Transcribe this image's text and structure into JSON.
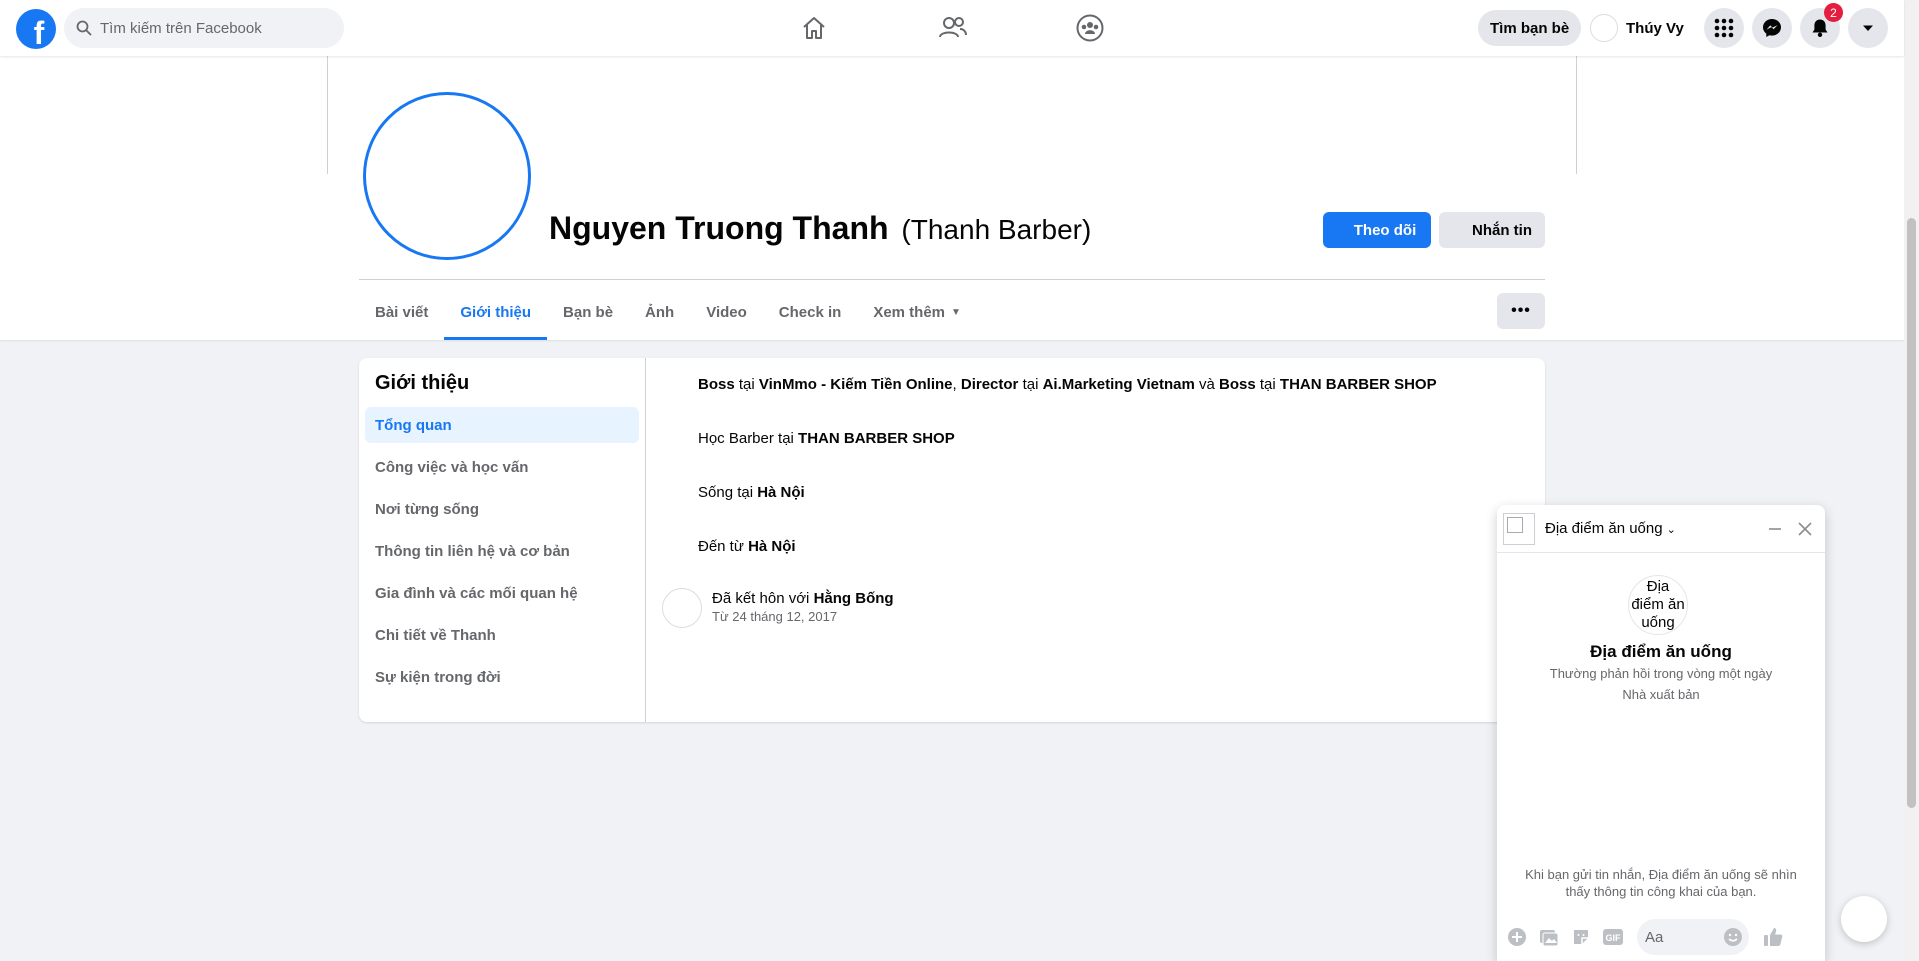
{
  "topbar": {
    "logo_letter": "f",
    "search_placeholder": "Tìm kiếm trên Facebook",
    "find_friends_label": "Tìm bạn bè",
    "user_name": "Thúy Vy",
    "notifications_badge": "2",
    "brand_color": "#1877f2"
  },
  "profile": {
    "name": "Nguyen Truong Thanh",
    "alt_name": "(Thanh Barber)",
    "follow_label": "Theo dõi",
    "message_label": "Nhắn tin",
    "more_label": "•••"
  },
  "tabs": [
    {
      "label": "Bài viết"
    },
    {
      "label": "Giới thiệu"
    },
    {
      "label": "Bạn bè"
    },
    {
      "label": "Ảnh"
    },
    {
      "label": "Video"
    },
    {
      "label": "Check in"
    },
    {
      "label": "Xem thêm"
    }
  ],
  "about": {
    "title": "Giới thiệu",
    "sidebar": [
      {
        "label": "Tổng quan"
      },
      {
        "label": "Công việc và học vấn"
      },
      {
        "label": "Nơi từng sống"
      },
      {
        "label": "Thông tin liên hệ và cơ bản"
      },
      {
        "label": "Gia đình và các mối quan hệ"
      },
      {
        "label": "Chi tiết về Thanh"
      },
      {
        "label": "Sự kiện trong đời"
      }
    ],
    "work": {
      "role1": "Boss",
      "at1": "tại",
      "company1": "VinMmo - Kiếm Tiền Online",
      "sep1": ",",
      "role2": "Director",
      "at2": "tại",
      "company2": "Ai.Marketing Vietnam",
      "and": "và",
      "role3": "Boss",
      "at3": "tại",
      "company3": "THAN BARBER SHOP"
    },
    "education": {
      "prefix": "Học Barber tại",
      "school": "THAN BARBER SHOP"
    },
    "lives": {
      "prefix": "Sống tại",
      "place": "Hà Nội"
    },
    "from": {
      "prefix": "Đến từ",
      "place": "Hà Nội"
    },
    "relationship": {
      "prefix": "Đã kết hôn với",
      "partner": "Hằng Bống",
      "since": "Từ 24 tháng 12, 2017"
    }
  },
  "chat": {
    "header_title": "Địa điểm ăn uống",
    "avatar_alt": "Địa điểm ăn uống",
    "page_name": "Địa điểm ăn uống",
    "response_time": "Thường phản hồi trong vòng một ngày",
    "role": "Nhà xuất bản",
    "privacy_notice": "Khi bạn gửi tin nhắn, Địa điểm ăn uống sẽ nhìn thấy thông tin công khai của bạn.",
    "input_placeholder": "Aa",
    "gif_label": "GIF"
  }
}
